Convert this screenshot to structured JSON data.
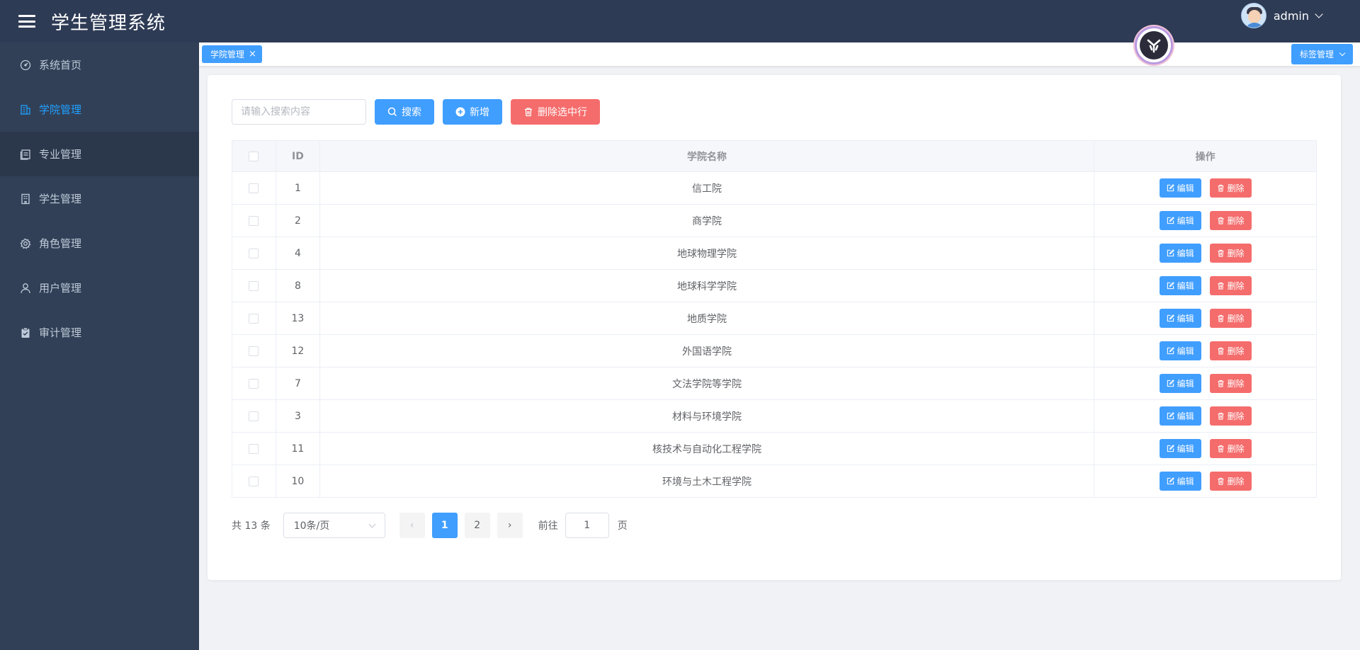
{
  "header": {
    "title": "学生管理系统",
    "username": "admin"
  },
  "sidebar": {
    "items": [
      {
        "label": "系统首页",
        "icon": "dashboard-icon"
      },
      {
        "label": "学院管理",
        "icon": "building-icon",
        "active": true
      },
      {
        "label": "专业管理",
        "icon": "document-icon"
      },
      {
        "label": "学生管理",
        "icon": "office-icon"
      },
      {
        "label": "角色管理",
        "icon": "gear-icon"
      },
      {
        "label": "用户管理",
        "icon": "user-icon"
      },
      {
        "label": "审计管理",
        "icon": "clipboard-check-icon"
      }
    ]
  },
  "tags": {
    "active_tag": "学院管理",
    "manage_label": "标签管理"
  },
  "toolbar": {
    "search_placeholder": "请输入搜索内容",
    "search_label": "搜索",
    "add_label": "新增",
    "delete_selected_label": "删除选中行"
  },
  "table": {
    "headers": {
      "id": "ID",
      "name": "学院名称",
      "actions": "操作"
    },
    "edit_label": "编辑",
    "delete_label": "删除",
    "rows": [
      {
        "id": "1",
        "name": "信工院"
      },
      {
        "id": "2",
        "name": "商学院"
      },
      {
        "id": "4",
        "name": "地球物理学院"
      },
      {
        "id": "8",
        "name": "地球科学学院"
      },
      {
        "id": "13",
        "name": "地质学院"
      },
      {
        "id": "12",
        "name": "外国语学院"
      },
      {
        "id": "7",
        "name": "文法学院等学院"
      },
      {
        "id": "3",
        "name": "材料与环境学院"
      },
      {
        "id": "11",
        "name": "核技术与自动化工程学院"
      },
      {
        "id": "10",
        "name": "环境与土木工程学院"
      }
    ]
  },
  "pagination": {
    "total_text": "共 13 条",
    "page_size": "10条/页",
    "pages": [
      "1",
      "2"
    ],
    "current_page": "1",
    "goto_label": "前往",
    "goto_value": "1",
    "page_unit": "页"
  },
  "colors": {
    "header_bg": "#2e3b55",
    "sidebar_bg": "#324057",
    "primary": "#409eff",
    "danger": "#f56c6c",
    "active_menu": "#20a0ff"
  }
}
